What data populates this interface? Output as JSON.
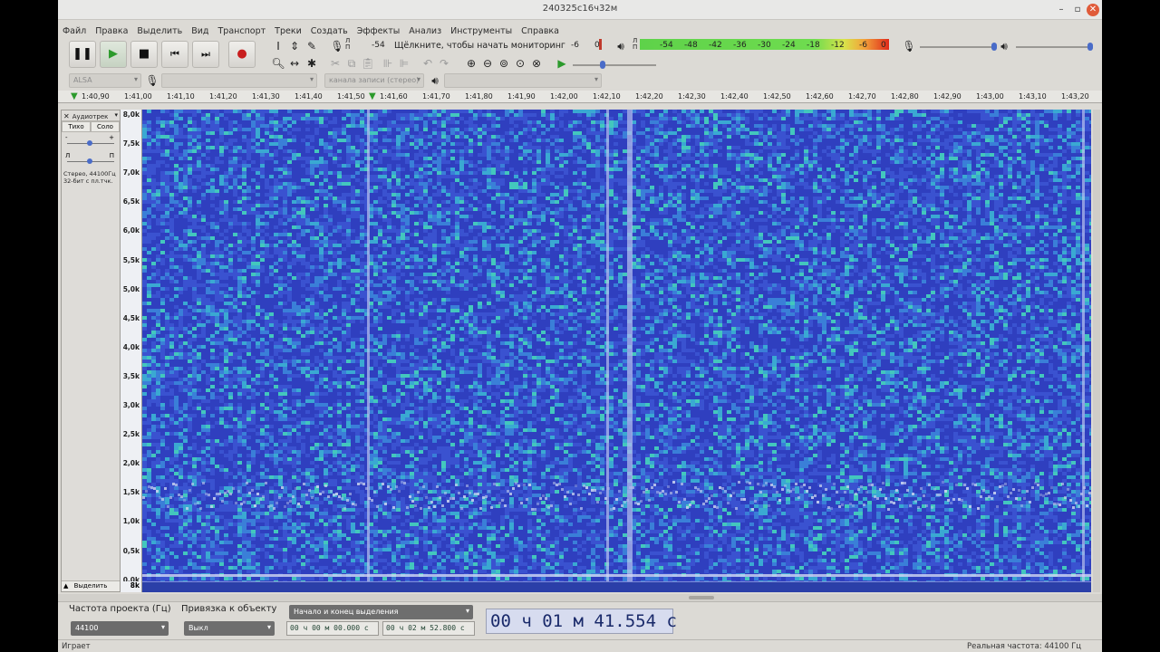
{
  "window": {
    "title": "240325с16ч32м"
  },
  "menu": [
    "Файл",
    "Правка",
    "Выделить",
    "Вид",
    "Транспорт",
    "Треки",
    "Создать",
    "Эффекты",
    "Анализ",
    "Инструменты",
    "Справка"
  ],
  "meters": {
    "rec_lp": "Л\nП",
    "rec_left_db": "-54",
    "rec_prompt": "Щёлкните, чтобы начать мониторинг",
    "rec_minus6": "-6",
    "rec_zero": "0",
    "play_ticks": [
      "-54",
      "-48",
      "-42",
      "-36",
      "-30",
      "-24",
      "-18",
      "-12",
      "-6"
    ],
    "play_zero": "0"
  },
  "devices": {
    "host": "ALSA",
    "rec_channels": "канала записи (стерео)"
  },
  "ruler": [
    "1:40,90",
    "1:41,00",
    "1:41,10",
    "1:41,20",
    "1:41,30",
    "1:41,40",
    "1:41,50",
    "1:41,60",
    "1:41,70",
    "1:41,80",
    "1:41,90",
    "1:42,00",
    "1:42,10",
    "1:42,20",
    "1:42,30",
    "1:42,40",
    "1:42,50",
    "1:42,60",
    "1:42,70",
    "1:42,80",
    "1:42,90",
    "1:43,00",
    "1:43,10",
    "1:43,20"
  ],
  "track": {
    "name": "Аудиотрек",
    "mute": "Тихо",
    "solo": "Соло",
    "pan_l": "Л",
    "pan_r": "П",
    "info1": "Стерео, 44100Гц",
    "info2": "32-бит с пл.тчк.",
    "select": "Выделить",
    "gain_minus": "-",
    "gain_plus": "+"
  },
  "yaxis": [
    "8,0k",
    "7,5k",
    "7,0k",
    "6,5k",
    "6,0k",
    "5,5k",
    "5,0k",
    "4,5k",
    "4,0k",
    "3,5k",
    "3,0k",
    "2,5k",
    "2,0k",
    "1,5k",
    "1,0k",
    "0,5k",
    "0,0k"
  ],
  "yaxis_bottom": "8k",
  "selection": {
    "rate_label": "Частота проекта (Гц)",
    "rate_value": "44100",
    "snap_label": "Привязка к объекту",
    "snap_value": "Выкл",
    "mode": "Начало и конец выделения",
    "start": "00 ч 00 м 00.000 с",
    "end": "00 ч 02 м 52.800 с",
    "position": "00 ч 01 м 41.554 с"
  },
  "status": {
    "left": "Играет",
    "right": "Реальная частота: 44100 Гц"
  },
  "colors": {
    "spectro_bg": "#3a4dc9",
    "spectro_hot": "#c9d3ef",
    "meter_green": "#5ed24a",
    "meter_red": "#e02a1a"
  }
}
